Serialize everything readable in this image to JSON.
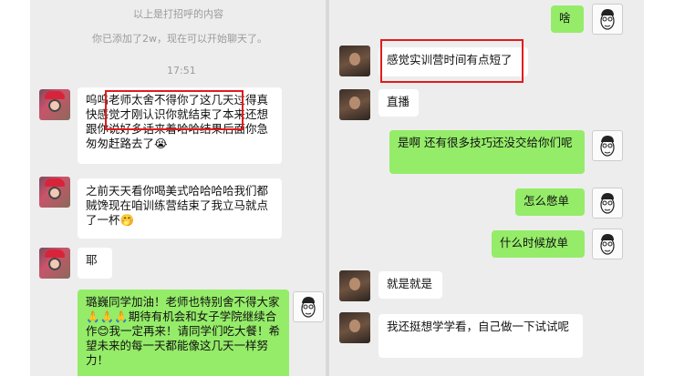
{
  "left_chat": {
    "system_greeting_note": "以上是打招呼的内容",
    "system_added_note": "你已添加了2w，现在可以开始聊天了。",
    "timestamp": "17:51",
    "messages": [
      {
        "sender": "student",
        "text": "呜呜老师太舍不得你了这几天过得真快感觉才刚认识你就结束了本来还想跟你说好多话来着哈哈结果后面你急匆匆赶路去了😭"
      },
      {
        "sender": "student",
        "text": "之前天天看你喝美式哈哈哈哈我们都贼馋现在咱训练营结束了我立马就点了一杯🤭"
      },
      {
        "sender": "student",
        "text": "耶"
      },
      {
        "sender": "teacher",
        "text": "璐巍同学加油！老师也特别舍不得大家🙏🙏🙏期待有机会和女子学院继续合作😊我一定再来！请同学们吃大餐！希望未来的每一天都能像这几天一样努力！"
      }
    ]
  },
  "right_chat": {
    "messages": [
      {
        "sender": "me",
        "text": "啥"
      },
      {
        "sender": "other",
        "text": "感觉实训营时间有点短了"
      },
      {
        "sender": "other",
        "text": "直播"
      },
      {
        "sender": "me",
        "text": "是啊 还有很多技巧还没交给你们呢"
      },
      {
        "sender": "me",
        "text": "怎么憋单"
      },
      {
        "sender": "me",
        "text": "什么时候放单"
      },
      {
        "sender": "other",
        "text": "就是就是"
      },
      {
        "sender": "other",
        "text": "我还挺想学学看，自己做一下试试呢"
      }
    ]
  },
  "colors": {
    "chat_background": "#ededed",
    "green_bubble": "#95ec69",
    "white_bubble": "#ffffff",
    "highlight_box": "#e21b1b"
  },
  "icons": {
    "student_avatar": "girl-red-hat-avatar",
    "teacher_avatar": "sketch-face-avatar",
    "other_avatar": "dark-photo-avatar"
  }
}
